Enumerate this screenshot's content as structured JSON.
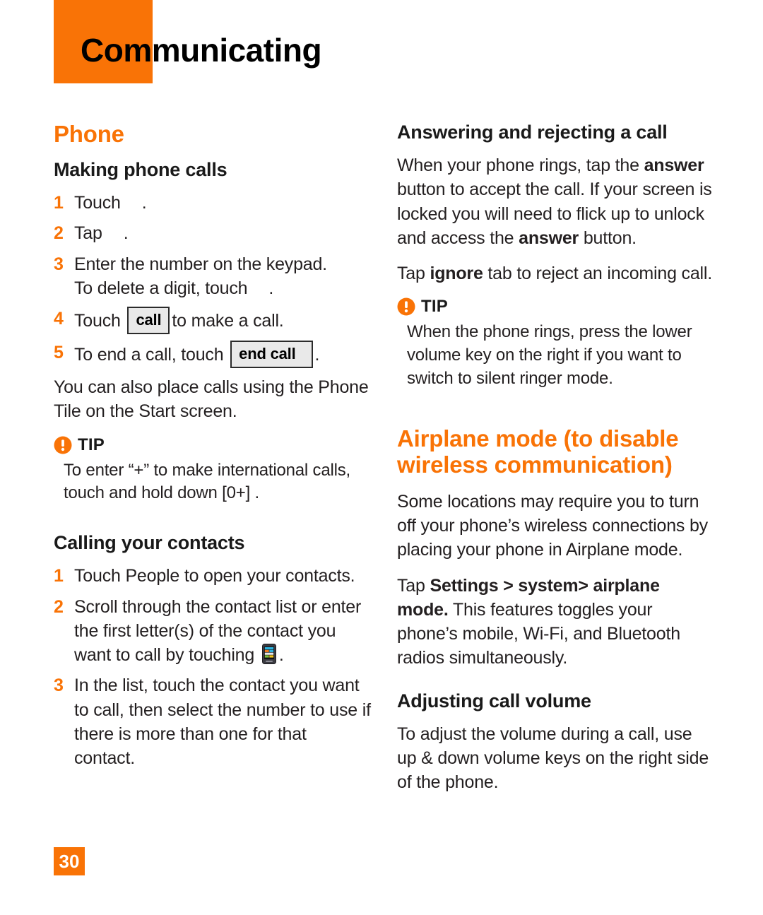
{
  "header": {
    "chapter_title": "Communicating",
    "accent_color": "#F97306"
  },
  "left_column": {
    "phone_heading": "Phone",
    "making_calls_heading": "Making phone calls",
    "steps": [
      {
        "num": "1",
        "text_before": "Touch",
        "text_after": "."
      },
      {
        "num": "2",
        "text_before": "Tap",
        "text_after": "."
      },
      {
        "num": "3",
        "line1": "Enter the number on the keypad.",
        "line2_before": "To delete a digit, touch",
        "line2_after": "."
      },
      {
        "num": "4",
        "before": "Touch",
        "button": "call",
        "after": "to make a call."
      },
      {
        "num": "5",
        "before": "To end a call, touch",
        "button": "end call",
        "after": "."
      }
    ],
    "phone_tile_note": "You can also place calls using the Phone Tile on the Start screen.",
    "tip": {
      "label": "TIP",
      "body": "To enter “+” to make international calls, touch and hold down [0+] ."
    },
    "contacts_heading": "Calling your contacts",
    "contacts_steps": [
      {
        "num": "1",
        "text": "Touch People to open your contacts."
      },
      {
        "num": "2",
        "text_before": "Scroll through the contact list or enter the first letter(s) of the contact you want to call by touching",
        "text_after": "."
      },
      {
        "num": "3",
        "text": "In the list, touch the contact you want to call, then select the number to use if there is more than one for that contact."
      }
    ]
  },
  "right_column": {
    "answering_heading": "Answering and rejecting a call",
    "answering_p1_a": "When your phone rings, tap the ",
    "answering_p1_b": "answer",
    "answering_p1_c": " button to accept the call.  If your screen is locked you will need to flick up to unlock and access the ",
    "answering_p1_d": "answer",
    "answering_p1_e": " button.",
    "ignore_a": "Tap ",
    "ignore_b": "ignore",
    "ignore_c": " tab to reject an incoming call.",
    "tip": {
      "label": "TIP",
      "body": "When the phone rings, press the lower volume key on the right if you want to switch to silent ringer mode."
    },
    "airplane_heading": "Airplane mode (to disable wireless communication)",
    "airplane_p1": "Some locations may require you to turn off your phone’s wireless connections by placing your phone in Airplane mode.",
    "airplane_p2_a": "Tap ",
    "airplane_p2_b": "Settings > system> airplane mode.",
    "airplane_p2_c": " This features toggles your phone’s mobile, Wi-Fi, and Bluetooth radios simultaneously.",
    "volume_heading": "Adjusting call volume",
    "volume_p1": "To adjust the volume during a call, use up & down volume keys on the right side of the phone."
  },
  "footer": {
    "page_number": "30"
  }
}
